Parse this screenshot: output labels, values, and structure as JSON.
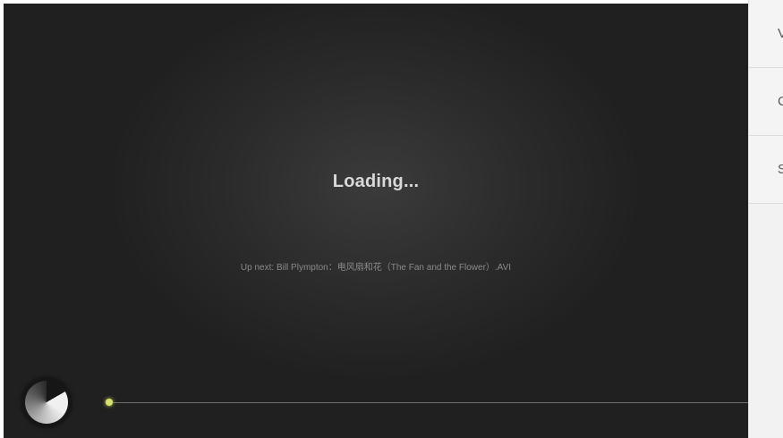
{
  "player": {
    "loading_text": "Loading...",
    "up_next_text": "Up next: Bill Plympton：电风扇和花（The Fan and the Flower）.AVI",
    "progress_fraction": 0.0,
    "accent_color": "#d7e36a"
  },
  "side_panel": {
    "items": [
      {
        "label": "V"
      },
      {
        "label": "C"
      },
      {
        "label": "S"
      }
    ]
  },
  "icons": {
    "knob": "volume-knob-icon"
  }
}
